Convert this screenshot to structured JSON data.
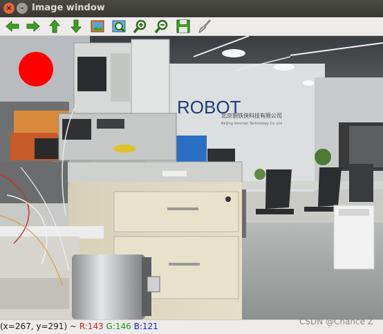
{
  "window": {
    "title": "Image window",
    "close_glyph": "×",
    "minimize_glyph": "–"
  },
  "toolbar": {
    "buttons": [
      {
        "name": "pan-left",
        "icon": "arrow-left-icon"
      },
      {
        "name": "pan-right",
        "icon": "arrow-right-icon"
      },
      {
        "name": "pan-up",
        "icon": "arrow-up-icon"
      },
      {
        "name": "pan-down",
        "icon": "arrow-down-icon"
      },
      {
        "name": "zoom-to-fit",
        "icon": "image-icon"
      },
      {
        "name": "zoom-original",
        "icon": "zoom-original-icon"
      },
      {
        "name": "zoom-in",
        "icon": "zoom-in-icon"
      },
      {
        "name": "zoom-out",
        "icon": "zoom-out-icon"
      },
      {
        "name": "save",
        "icon": "save-icon"
      },
      {
        "name": "properties",
        "icon": "brush-icon"
      }
    ]
  },
  "image": {
    "wall_logo": "ROBOT",
    "wall_company_cn": "北京钢铁侠科技有限公司",
    "wall_company_en": "Beijing Ironman Technology Co.,Ltd",
    "marker_color": "#ff0000"
  },
  "status": {
    "coords": "(x=267, y=291) ~ ",
    "r": "R:143",
    "g": "G:146",
    "b": "B:121"
  },
  "watermark": "CSDN @Chance Z",
  "colors": {
    "titlebar": "#3c3b37",
    "toolbar": "#edeceb",
    "arrow_green": "#3a9a1e"
  }
}
